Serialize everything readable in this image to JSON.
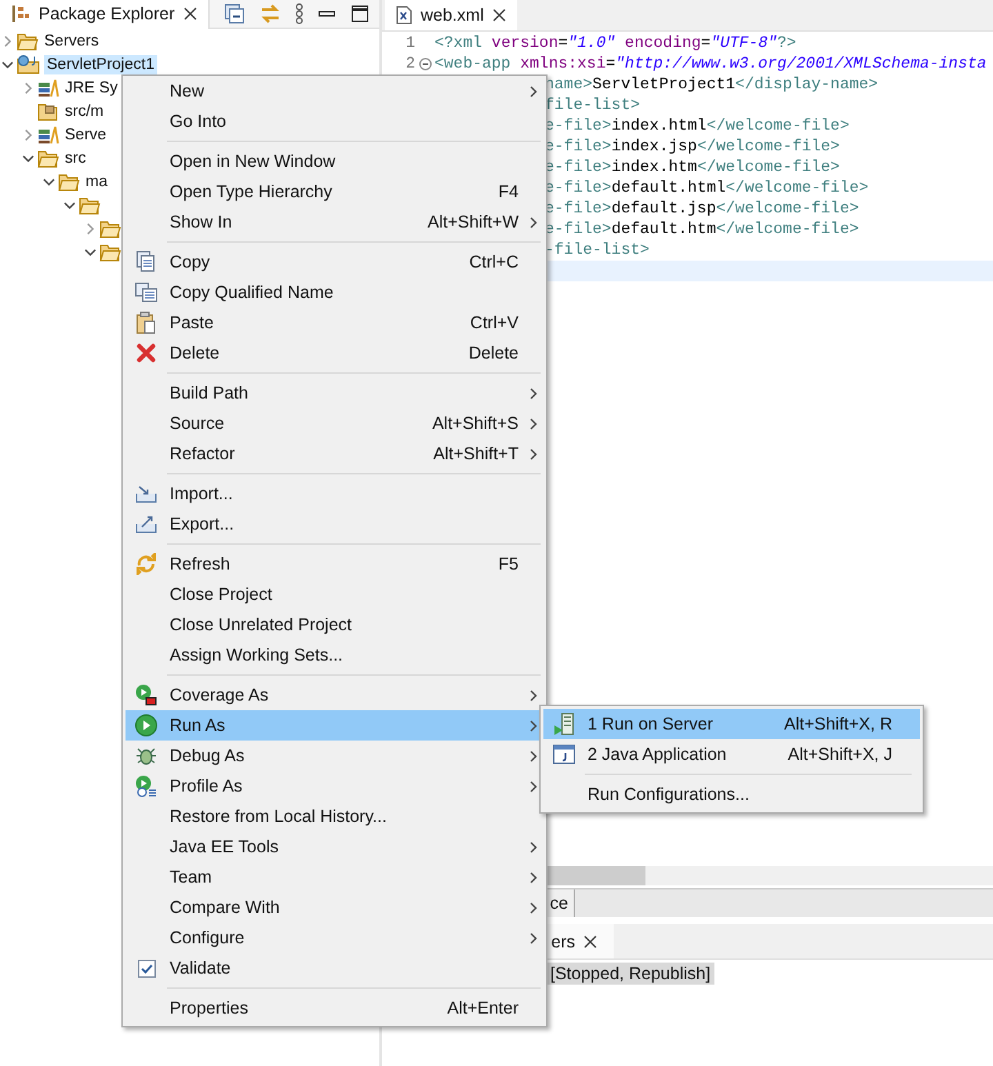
{
  "explorer": {
    "tab": {
      "label": "Package Explorer"
    },
    "tree": [
      {
        "label": "Servers",
        "kind": "folder",
        "expanded": false,
        "selected": false
      },
      {
        "label": "ServletProject1",
        "kind": "project",
        "expanded": true,
        "selected": true,
        "children": [
          {
            "label": "JRE Sy",
            "kind": "library",
            "expanded": false,
            "selected": false
          },
          {
            "label": "src/m",
            "kind": "package-folder",
            "selected": false
          },
          {
            "label": "Serve",
            "kind": "library",
            "expanded": false,
            "selected": false
          },
          {
            "label": "src",
            "kind": "folder",
            "expanded": true,
            "selected": false,
            "children": [
              {
                "label": "ma",
                "kind": "folder",
                "expanded": true,
                "selected": false,
                "children": [
                  {
                    "kind": "folder",
                    "expanded": true,
                    "selected": false,
                    "children": [
                      {
                        "kind": "folder",
                        "expanded": false,
                        "selected": false
                      },
                      {
                        "kind": "folder",
                        "expanded": true,
                        "selected": false
                      }
                    ]
                  }
                ]
              }
            ]
          }
        ]
      }
    ]
  },
  "editor": {
    "tab": {
      "label": "web.xml"
    },
    "lines": [
      {
        "kind": "full",
        "number": "1",
        "current": false,
        "segments": [
          {
            "kind": "tag",
            "text": "<?xml"
          },
          {
            "kind": "attr",
            "text": " version"
          },
          {
            "kind": "text",
            "text": "="
          },
          {
            "kind": "value",
            "text": "\"1.0\""
          },
          {
            "kind": "attr",
            "text": " encoding"
          },
          {
            "kind": "text",
            "text": "="
          },
          {
            "kind": "value",
            "text": "\"UTF-8\""
          },
          {
            "kind": "tag",
            "text": "?>"
          }
        ]
      },
      {
        "kind": "full",
        "number": "2",
        "folded": false,
        "current": false,
        "segments": [
          {
            "kind": "tag",
            "text": "<web-app"
          },
          {
            "kind": "attr",
            "text": " xmlns:xsi"
          },
          {
            "kind": "text",
            "text": "="
          },
          {
            "kind": "value",
            "text": "\"http://www.w3.org/2001/XMLSchema-insta"
          }
        ]
      },
      {
        "kind": "cut",
        "current": false,
        "segments": [
          {
            "kind": "tag",
            "text": "name>"
          },
          {
            "kind": "text",
            "text": "ServletProject1"
          },
          {
            "kind": "tag",
            "text": "</display-name>"
          }
        ]
      },
      {
        "kind": "cut",
        "current": false,
        "segments": [
          {
            "kind": "tag",
            "text": "file-list>"
          }
        ]
      },
      {
        "kind": "cut",
        "current": false,
        "segments": [
          {
            "kind": "tag",
            "text": "e-file>"
          },
          {
            "kind": "text",
            "text": "index.html"
          },
          {
            "kind": "tag",
            "text": "</welcome-file>"
          }
        ]
      },
      {
        "kind": "cut",
        "current": false,
        "segments": [
          {
            "kind": "tag",
            "text": "e-file>"
          },
          {
            "kind": "text",
            "text": "index.jsp"
          },
          {
            "kind": "tag",
            "text": "</welcome-file>"
          }
        ]
      },
      {
        "kind": "cut",
        "current": false,
        "segments": [
          {
            "kind": "tag",
            "text": "e-file>"
          },
          {
            "kind": "text",
            "text": "index.htm"
          },
          {
            "kind": "tag",
            "text": "</welcome-file>"
          }
        ]
      },
      {
        "kind": "cut",
        "current": false,
        "segments": [
          {
            "kind": "tag",
            "text": "e-file>"
          },
          {
            "kind": "text",
            "text": "default.html"
          },
          {
            "kind": "tag",
            "text": "</welcome-file>"
          }
        ]
      },
      {
        "kind": "cut",
        "current": false,
        "segments": [
          {
            "kind": "tag",
            "text": "e-file>"
          },
          {
            "kind": "text",
            "text": "default.jsp"
          },
          {
            "kind": "tag",
            "text": "</welcome-file>"
          }
        ]
      },
      {
        "kind": "cut",
        "current": false,
        "segments": [
          {
            "kind": "tag",
            "text": "e-file>"
          },
          {
            "kind": "text",
            "text": "default.htm"
          },
          {
            "kind": "tag",
            "text": "</welcome-file>"
          }
        ]
      },
      {
        "kind": "cut",
        "current": false,
        "segments": [
          {
            "kind": "tag",
            "text": "-file-list>"
          }
        ]
      },
      {
        "kind": "cut",
        "current": true
      }
    ]
  },
  "bottom_tab": {
    "label": "ce"
  },
  "servers_view": {
    "tab": {
      "label": "ers"
    },
    "rows": [
      {
        "label": "[Stopped, Republish]",
        "selected": true
      }
    ]
  },
  "context_menu": {
    "items": [
      {
        "kind": "item",
        "label": "New",
        "has_submenu": true,
        "selected": false,
        "checked": false
      },
      {
        "kind": "item",
        "label": "Go Into",
        "has_submenu": false,
        "selected": false,
        "checked": false
      },
      {
        "kind": "separator"
      },
      {
        "kind": "item",
        "label": "Open in New Window",
        "has_submenu": false,
        "selected": false,
        "checked": false
      },
      {
        "kind": "item",
        "label": "Open Type Hierarchy",
        "shortcut": "F4",
        "has_submenu": false,
        "selected": false,
        "checked": false
      },
      {
        "kind": "item",
        "label": "Show In",
        "shortcut": "Alt+Shift+W",
        "has_submenu": true,
        "selected": false,
        "checked": false
      },
      {
        "kind": "separator"
      },
      {
        "kind": "item",
        "label": "Copy",
        "shortcut": "Ctrl+C",
        "has_submenu": false,
        "selected": false,
        "checked": false
      },
      {
        "kind": "item",
        "label": "Copy Qualified Name",
        "has_submenu": false,
        "selected": false,
        "checked": false
      },
      {
        "kind": "item",
        "label": "Paste",
        "shortcut": "Ctrl+V",
        "has_submenu": false,
        "selected": false,
        "checked": false
      },
      {
        "kind": "item",
        "label": "Delete",
        "shortcut": "Delete",
        "has_submenu": false,
        "selected": false,
        "checked": false
      },
      {
        "kind": "separator"
      },
      {
        "kind": "item",
        "label": "Build Path",
        "has_submenu": true,
        "selected": false,
        "checked": false
      },
      {
        "kind": "item",
        "label": "Source",
        "shortcut": "Alt+Shift+S",
        "has_submenu": true,
        "selected": false,
        "checked": false
      },
      {
        "kind": "item",
        "label": "Refactor",
        "shortcut": "Alt+Shift+T",
        "has_submenu": true,
        "selected": false,
        "checked": false
      },
      {
        "kind": "separator"
      },
      {
        "kind": "item",
        "label": "Import...",
        "has_submenu": false,
        "selected": false,
        "checked": false
      },
      {
        "kind": "item",
        "label": "Export...",
        "has_submenu": false,
        "selected": false,
        "checked": false
      },
      {
        "kind": "separator"
      },
      {
        "kind": "item",
        "label": "Refresh",
        "shortcut": "F5",
        "has_submenu": false,
        "selected": false,
        "checked": false
      },
      {
        "kind": "item",
        "label": "Close Project",
        "has_submenu": false,
        "selected": false,
        "checked": false
      },
      {
        "kind": "item",
        "label": "Close Unrelated Project",
        "has_submenu": false,
        "selected": false,
        "checked": false
      },
      {
        "kind": "item",
        "label": "Assign Working Sets...",
        "has_submenu": false,
        "selected": false,
        "checked": false
      },
      {
        "kind": "separator"
      },
      {
        "kind": "item",
        "label": "Coverage As",
        "has_submenu": true,
        "selected": false,
        "checked": false
      },
      {
        "kind": "item",
        "label": "Run As",
        "has_submenu": true,
        "selected": true,
        "checked": false
      },
      {
        "kind": "item",
        "label": "Debug As",
        "has_submenu": true,
        "selected": false,
        "checked": false
      },
      {
        "kind": "item",
        "label": "Profile As",
        "has_submenu": true,
        "selected": false,
        "checked": false
      },
      {
        "kind": "item",
        "label": "Restore from Local History...",
        "has_submenu": false,
        "selected": false,
        "checked": false
      },
      {
        "kind": "item",
        "label": "Java EE Tools",
        "has_submenu": true,
        "selected": false,
        "checked": false
      },
      {
        "kind": "item",
        "label": "Team",
        "has_submenu": true,
        "selected": false,
        "checked": false
      },
      {
        "kind": "item",
        "label": "Compare With",
        "has_submenu": true,
        "selected": false,
        "checked": false
      },
      {
        "kind": "item",
        "label": "Configure",
        "has_submenu": true,
        "selected": false,
        "checked": false
      },
      {
        "kind": "item",
        "label": "Validate",
        "has_submenu": false,
        "selected": false,
        "checked": true
      },
      {
        "kind": "separator"
      },
      {
        "kind": "item",
        "label": "Properties",
        "shortcut": "Alt+Enter",
        "has_submenu": false,
        "selected": false,
        "checked": false
      }
    ]
  },
  "submenu": {
    "items": [
      {
        "kind": "item",
        "label": "1 Run on Server",
        "shortcut": "Alt+Shift+X, R",
        "selected": true
      },
      {
        "kind": "item",
        "label": "2 Java Application",
        "shortcut": "Alt+Shift+X, J",
        "selected": false
      },
      {
        "kind": "separator"
      },
      {
        "kind": "item",
        "label": "Run Configurations...",
        "selected": false
      }
    ]
  }
}
